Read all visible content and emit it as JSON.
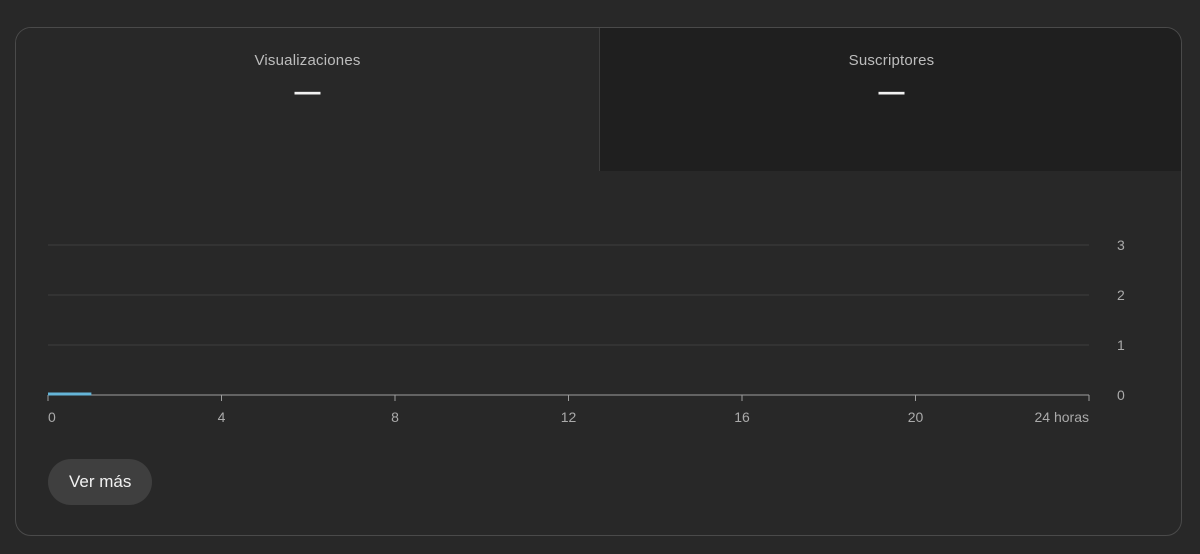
{
  "tabs": [
    {
      "label": "Visualizaciones",
      "value": "—"
    },
    {
      "label": "Suscriptores",
      "value": "—"
    }
  ],
  "chart_data": {
    "type": "line",
    "x": [
      0,
      1
    ],
    "series": [
      {
        "values": [
          0,
          0
        ]
      }
    ],
    "xticks": [
      0,
      4,
      8,
      12,
      16,
      20,
      24
    ],
    "xtick_labels": [
      "0",
      "4",
      "8",
      "12",
      "16",
      "20",
      "24 horas"
    ],
    "yticks": [
      0,
      1,
      2,
      3
    ],
    "ytick_labels": [
      "0",
      "1",
      "2",
      "3"
    ],
    "xlim": [
      0,
      24
    ],
    "ylim": [
      0,
      3
    ],
    "grid": true,
    "colors": {
      "series": "#65b5d8",
      "grid": "#3e3e3e",
      "axis": "#9e9e9e",
      "tick_text": "#aaaaaa"
    }
  },
  "actions": {
    "see_more_label": "Ver más"
  }
}
